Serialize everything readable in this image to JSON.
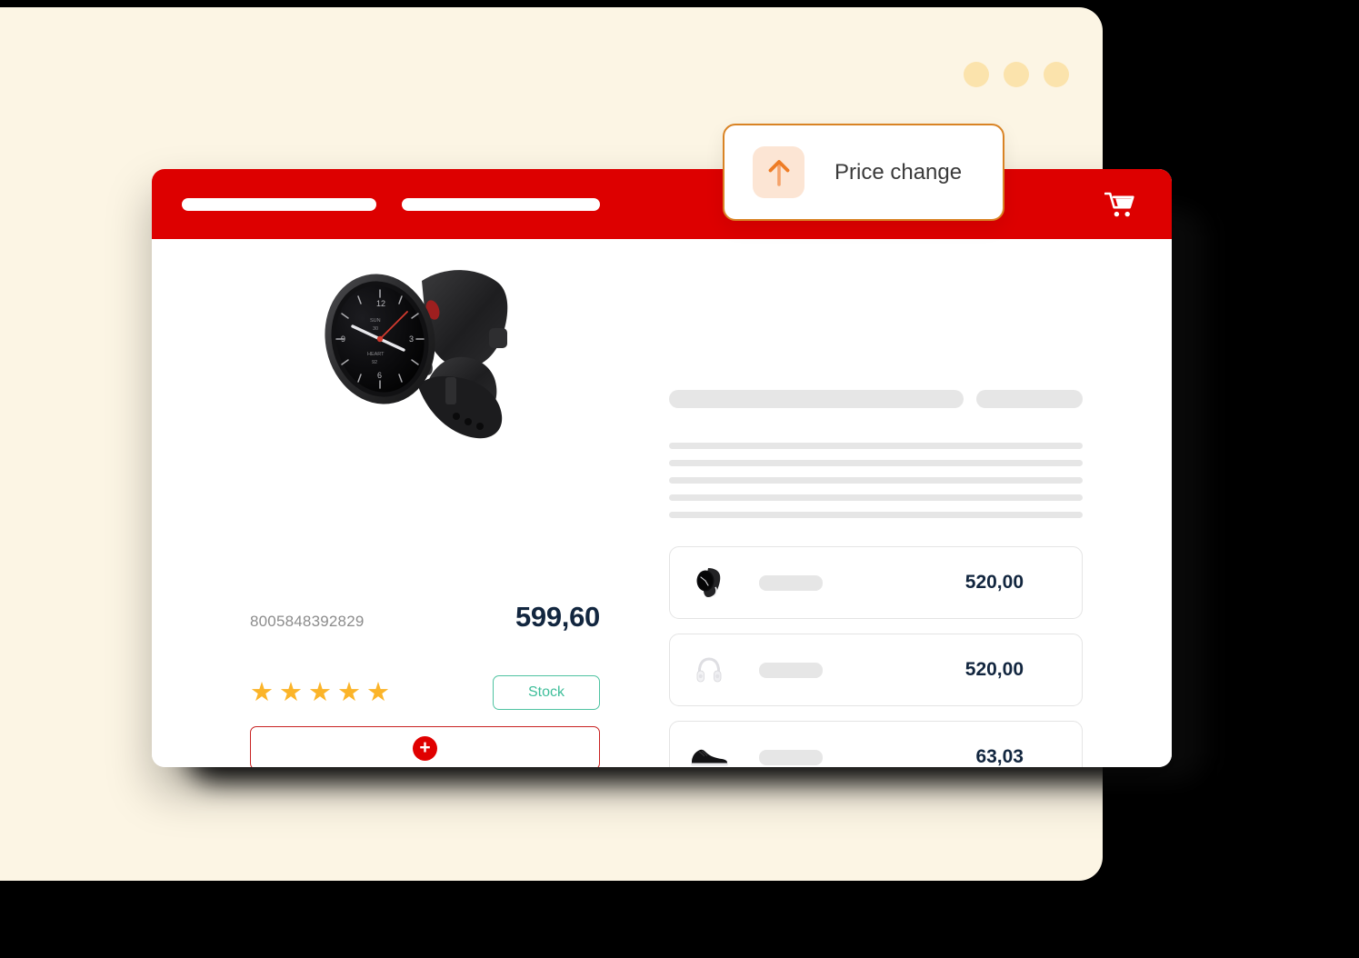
{
  "window": {
    "dots": [
      "dot-1",
      "dot-2",
      "dot-3"
    ],
    "dot_color": "#FBE3AC",
    "background_color": "#FCF5E4"
  },
  "notification": {
    "label": "Price change",
    "icon": "arrow-up-icon",
    "border_color": "#D98324",
    "icon_bg_color": "#FCE5D4",
    "icon_color": "#F08A3C"
  },
  "browser": {
    "header": {
      "brand_color": "#DD0000",
      "placeholder_bars": [
        "nav-placeholder-1",
        "nav-placeholder-2"
      ],
      "cart_icon": "shopping-cart-icon"
    }
  },
  "product": {
    "image_alt": "black-smartwatch",
    "barcode": "8005848392829",
    "price": "599,60",
    "price_color": "#12263F",
    "rating": 5,
    "star_glyph": "★",
    "star_color": "#FBB429",
    "stock_label": "Stock",
    "stock_color": "#3FBE9A",
    "add_button": {
      "icon": "plus-icon",
      "glyph": "+",
      "icon_bg_color": "#E00000",
      "border_color": "#C82222"
    }
  },
  "details": {
    "title_skeletons": [
      "skeleton-title-long",
      "skeleton-title-short"
    ],
    "text_skeletons": [
      "line-1",
      "line-2",
      "line-3",
      "line-4",
      "line-5"
    ],
    "skeleton_color": "#E6E6E6"
  },
  "related_products": [
    {
      "thumb": "smartwatch-thumb",
      "name_placeholder": "",
      "price": "520,00"
    },
    {
      "thumb": "headphones-thumb",
      "name_placeholder": "",
      "price": "520,00"
    },
    {
      "thumb": "sneaker-thumb",
      "name_placeholder": "",
      "price": "63,03"
    }
  ]
}
